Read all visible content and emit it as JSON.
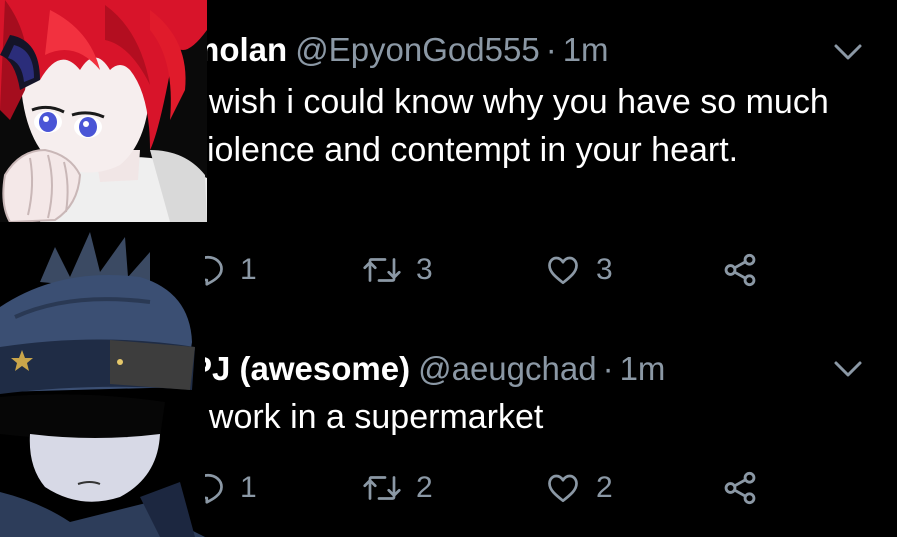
{
  "tweets": [
    {
      "name": "molan",
      "handle": "@EpyonGod555",
      "separator": "·",
      "time": "1m",
      "text": "I wish i could know why you have so much violence and contempt in your heart.",
      "replies": "1",
      "retweets": "3",
      "likes": "3"
    },
    {
      "name": "PJ (awesome)",
      "handle": "@aeugchad",
      "separator": "·",
      "time": "1m",
      "text": "I work in a supermarket",
      "replies": "1",
      "retweets": "2",
      "likes": "2"
    }
  ],
  "icons": {
    "reply": "reply-icon",
    "retweet": "retweet-icon",
    "like": "heart-icon",
    "share": "share-icon",
    "menu": "chevron-down-icon"
  },
  "colors": {
    "background": "#000000",
    "text": "#ffffff",
    "muted": "#8b98a5"
  }
}
